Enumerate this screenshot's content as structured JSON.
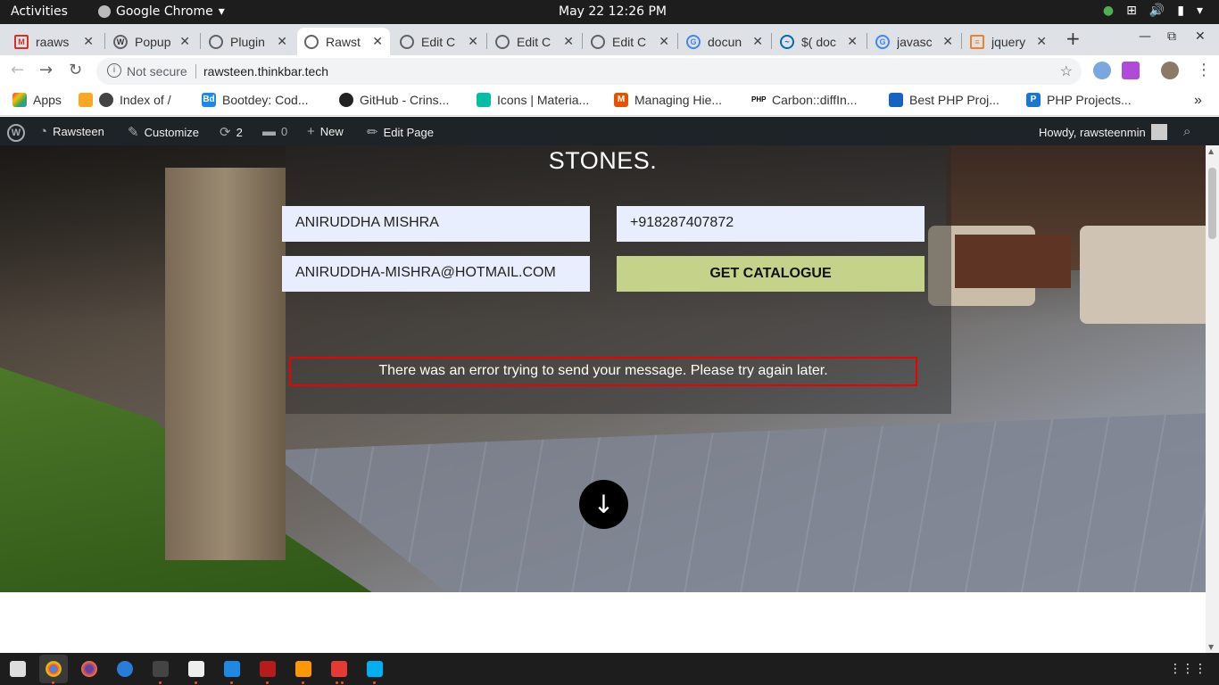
{
  "system": {
    "activities": "Activities",
    "app_name": "Google Chrome",
    "clock": "May 22  12:26 PM"
  },
  "tabs": [
    {
      "label": "raaws",
      "favicon": "gmail-icon"
    },
    {
      "label": "Popup",
      "favicon": "wordpress-icon"
    },
    {
      "label": "Plugin",
      "favicon": "globe-icon"
    },
    {
      "label": "Rawst",
      "favicon": "globe-icon",
      "active": true
    },
    {
      "label": "Edit C",
      "favicon": "globe-icon"
    },
    {
      "label": "Edit C",
      "favicon": "globe-icon"
    },
    {
      "label": "Edit C",
      "favicon": "globe-icon"
    },
    {
      "label": "docun",
      "favicon": "google-icon"
    },
    {
      "label": "$( doc",
      "favicon": "jquery-icon"
    },
    {
      "label": "javasc",
      "favicon": "google-icon"
    },
    {
      "label": "jquery",
      "favicon": "stackoverflow-icon"
    }
  ],
  "toolbar": {
    "not_secure": "Not secure",
    "url": "rawsteen.thinkbar.tech"
  },
  "bookmarks": [
    {
      "label": "Apps",
      "icon": "apps-grid-icon"
    },
    {
      "label": "Index of /",
      "icon": "globe-icon"
    },
    {
      "label": "Bootdey: Cod...",
      "icon": "bootdey-icon"
    },
    {
      "label": "GitHub - Crins...",
      "icon": "github-icon"
    },
    {
      "label": "Icons | Materia...",
      "icon": "material-icon"
    },
    {
      "label": "Managing Hie...",
      "icon": "mysql-icon"
    },
    {
      "label": "Carbon::diffIn...",
      "icon": "php-icon"
    },
    {
      "label": "Best PHP Proj...",
      "icon": "bookmark-icon"
    },
    {
      "label": "PHP Projects...",
      "icon": "php-projects-icon"
    }
  ],
  "wp_admin": {
    "site": "Rawsteen",
    "customize": "Customize",
    "updates": "2",
    "comments": "0",
    "new": "New",
    "edit": "Edit Page",
    "howdy": "Howdy, rawsteenmin"
  },
  "hero": {
    "heading": "STONES.",
    "name_value": "ANIRUDDHA MISHRA",
    "phone_value": "+918287407872",
    "email_value": "ANIRUDDHA-MISHRA@HOTMAIL.COM",
    "submit": "GET CATALOGUE",
    "error": "There was an error trying to send your message. Please try again later.",
    "scroll_down": "↓"
  },
  "colors": {
    "submit_bg": "#c5d28a",
    "field_bg": "#e8eefe",
    "error_border": "#e00000",
    "wp_bar": "#1d2327"
  }
}
